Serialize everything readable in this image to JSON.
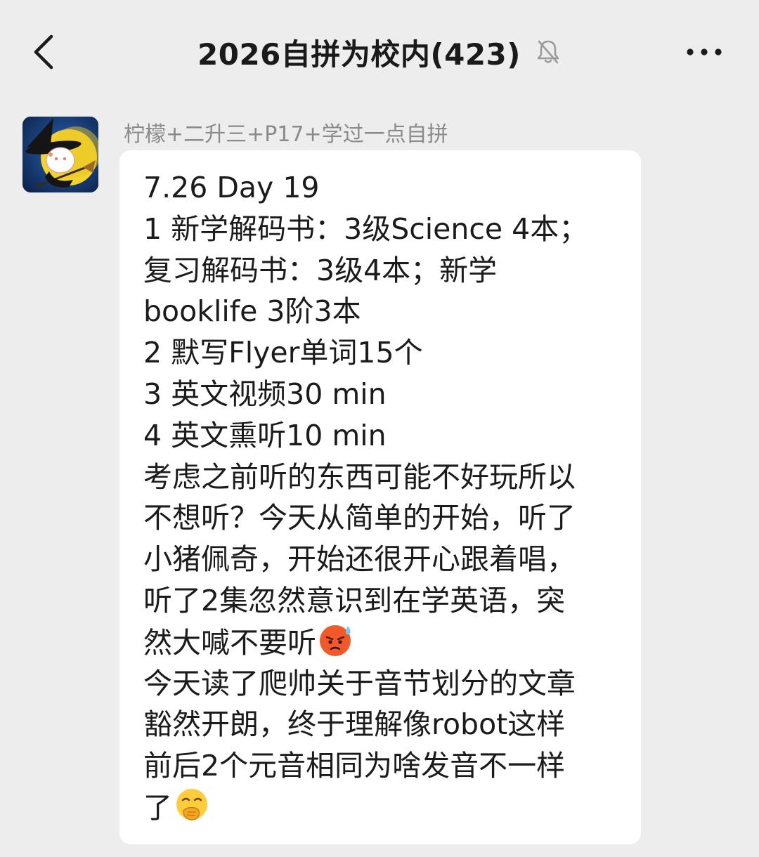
{
  "header": {
    "title": "2026自拼为校内(423)",
    "back_icon": "chevron-left-icon",
    "mute_icon": "bell-off-icon",
    "more_icon": "more-dots-icon"
  },
  "message": {
    "sender_name": "柠檬+二升三+P17+学过一点自拼",
    "avatar_icon": "witch-avatar",
    "lines": [
      "7.26 Day 19",
      "1 新学解码书：3级Science 4本；",
      "复习解码书：3级4本；新学",
      "booklife 3阶3本",
      "2 默写Flyer单词15个",
      "3 英文视频30 min",
      "4 英文熏听10 min",
      "考虑之前听的东西可能不好玩所以",
      "不想听？今天从简单的开始，听了",
      "小猪佩奇，开始还很开心跟着唱，",
      "听了2集忽然意识到在学英语，突",
      "然大喊不要听",
      "今天读了爬帅关于音节划分的文章",
      "豁然开朗，终于理解像robot这样",
      "前后2个元音相同为啥发音不一样",
      "了"
    ],
    "emojis": {
      "line_11": "angry-sweat-face-emoji",
      "line_15": "thinking-hand-over-mouth-emoji"
    }
  },
  "colors": {
    "background": "#ededed",
    "bubble": "#ffffff",
    "text": "#1b1b1b",
    "sender": "#8a8a8a"
  }
}
